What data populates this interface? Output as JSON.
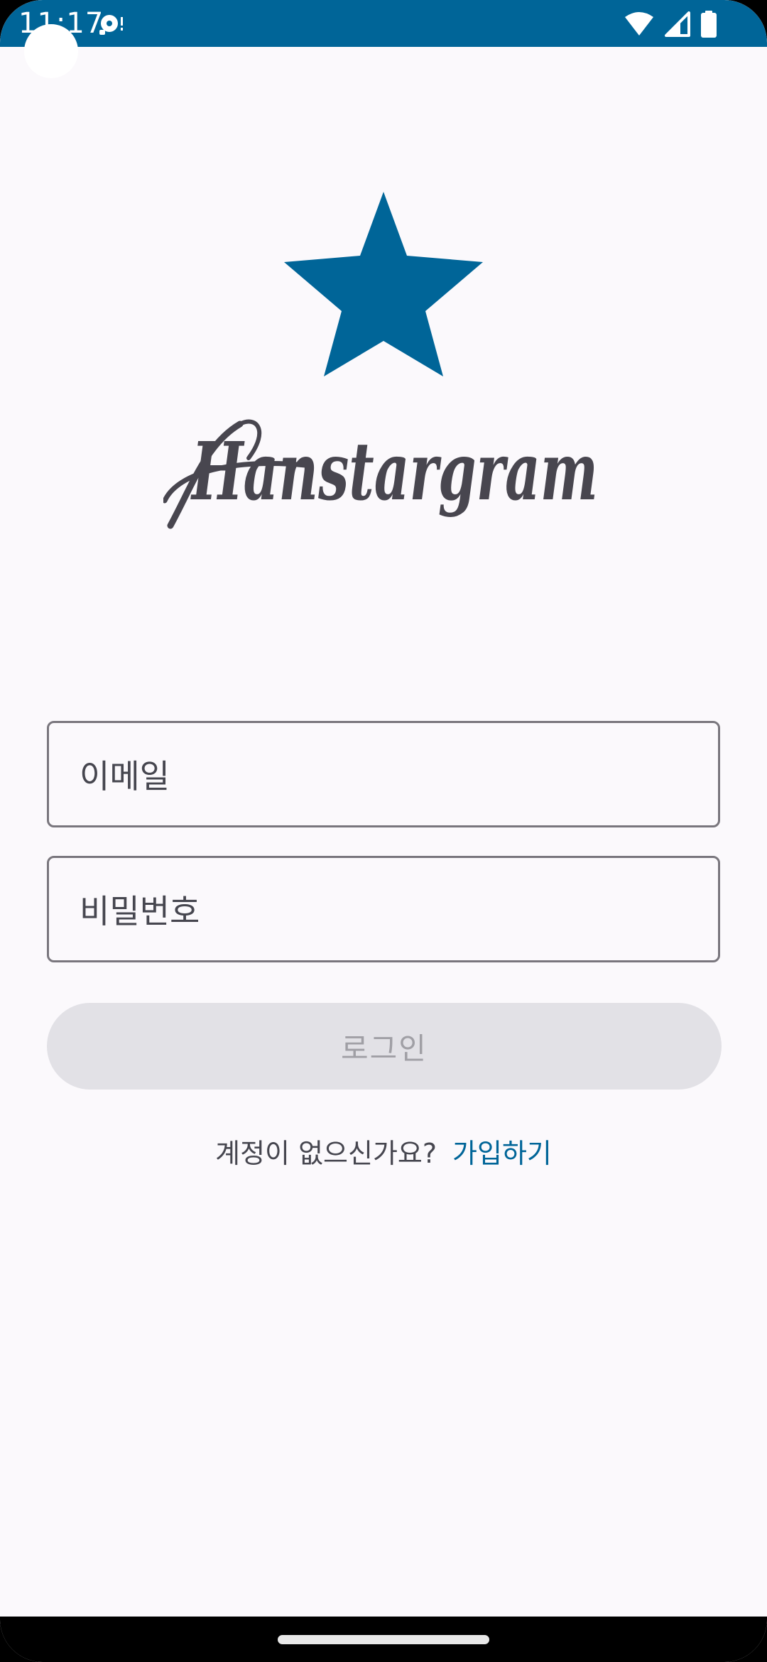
{
  "status_bar": {
    "time": "11:17",
    "notification_icon": "media-icon",
    "icons": [
      "wifi-icon",
      "cellular-signal-icon",
      "battery-icon"
    ],
    "background_color": "#006598"
  },
  "branding": {
    "logo_icon": "star-icon",
    "app_name": "Hanstargram",
    "brand_color": "#006598",
    "wordmark_color": "#48464f"
  },
  "login_form": {
    "email_label": "이메일",
    "password_label": "비밀번호",
    "login_button_label": "로그인",
    "login_button_enabled": false
  },
  "signup": {
    "prompt": "계정이 없으신가요?",
    "link_label": "가입하기"
  }
}
